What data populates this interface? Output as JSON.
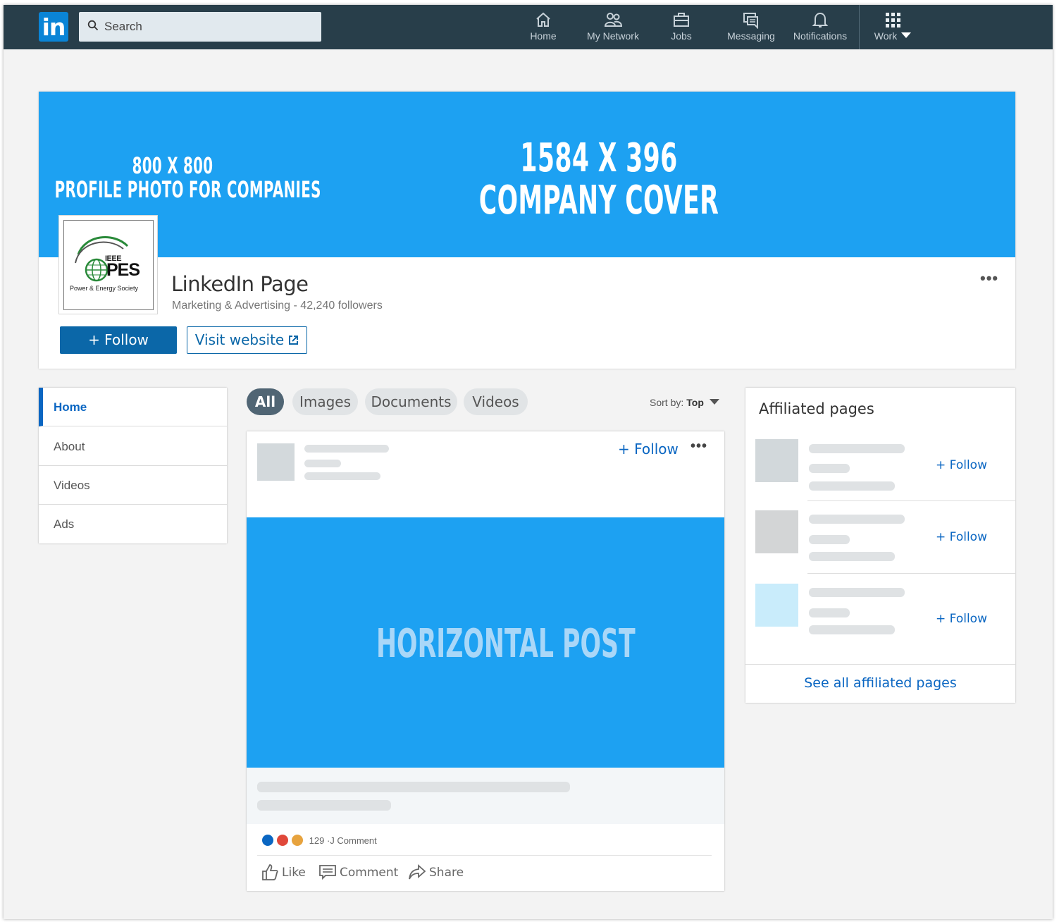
{
  "topnav": {
    "logo_text": "in",
    "search_placeholder": "Search",
    "items": [
      {
        "label": "Home",
        "icon": "home-icon"
      },
      {
        "label": "My Network",
        "icon": "people-icon"
      },
      {
        "label": "Jobs",
        "icon": "briefcase-icon"
      },
      {
        "label": "Messaging",
        "icon": "messaging-icon"
      },
      {
        "label": "Notifications",
        "icon": "bell-icon"
      },
      {
        "label": "Work",
        "icon": "grid-icon"
      }
    ]
  },
  "cover": {
    "profile_dims": "800 X 800",
    "profile_caption": "PROFILE PHOTO FOR COMPANIES",
    "cover_dims": "1584 X 396",
    "cover_caption": "COMPANY COVER",
    "logo_lines": [
      "IEEE",
      "PES",
      "Power & Energy Society"
    ]
  },
  "page": {
    "name": "LinkedIn Page",
    "subtitle": "Marketing & Advertising - 42,240 followers",
    "follow_label": "+ Follow",
    "visit_label": "Visit website"
  },
  "leftnav": {
    "items": [
      "Home",
      "About",
      "Videos",
      "Ads"
    ]
  },
  "filters": {
    "pills": [
      "All",
      "Images",
      "Documents",
      "Videos"
    ],
    "sort_label": "Sort by:",
    "sort_value": "Top"
  },
  "post": {
    "follow_label": "+ Follow",
    "image_text": "HORIZONTAL POST",
    "reaction_count": "129",
    "comment_count_label": "·J Comment",
    "actions": [
      "Like",
      "Comment",
      "Share"
    ]
  },
  "affiliated": {
    "title": "Affiliated pages",
    "follow_labels": [
      "+ Follow",
      "+ Follow",
      "+ Follow"
    ],
    "see_all": "See all affiliated pages"
  },
  "colors": {
    "nav_bg": "#283e4a",
    "brand_blue": "#0a66c2",
    "cover_blue": "#1da1f2",
    "page_bg": "#f3f3f3"
  }
}
